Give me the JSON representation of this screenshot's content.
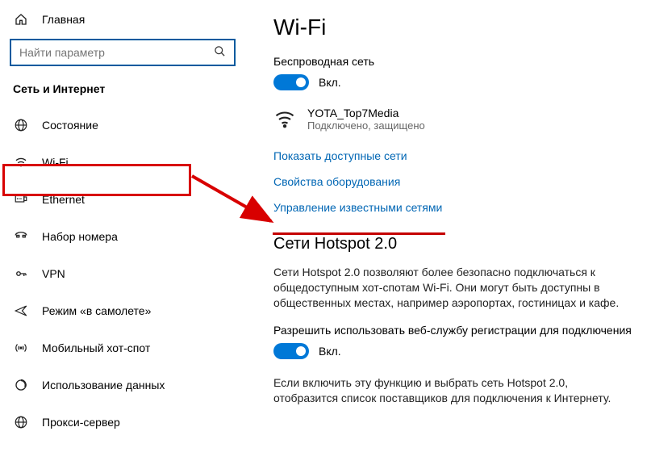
{
  "sidebar": {
    "home": "Главная",
    "search_placeholder": "Найти параметр",
    "section": "Сеть и Интернет",
    "items": [
      {
        "label": "Состояние"
      },
      {
        "label": "Wi-Fi"
      },
      {
        "label": "Ethernet"
      },
      {
        "label": "Набор номера"
      },
      {
        "label": "VPN"
      },
      {
        "label": "Режим «в самолете»"
      },
      {
        "label": "Мобильный хот-спот"
      },
      {
        "label": "Использование данных"
      },
      {
        "label": "Прокси-сервер"
      }
    ]
  },
  "main": {
    "title": "Wi-Fi",
    "wireless_label": "Беспроводная сеть",
    "toggle_state": "Вкл.",
    "network": {
      "name": "YOTA_Top7Media",
      "status": "Подключено, защищено"
    },
    "links": {
      "show_available": "Показать доступные сети",
      "hardware_props": "Свойства оборудования",
      "manage_known": "Управление известными сетями"
    },
    "hotspot": {
      "heading": "Сети Hotspot 2.0",
      "desc": "Сети Hotspot 2.0 позволяют более безопасно подключаться к общедоступным хот-спотам Wi-Fi. Они могут быть доступны в общественных местах, например аэропортах, гостиницах и кафе.",
      "allow_label": "Разрешить использовать веб-службу регистрации для подключения",
      "toggle_state": "Вкл.",
      "note": "Если включить эту функцию и выбрать сеть Hotspot 2.0, отобразится список поставщиков для подключения к Интернету."
    }
  }
}
